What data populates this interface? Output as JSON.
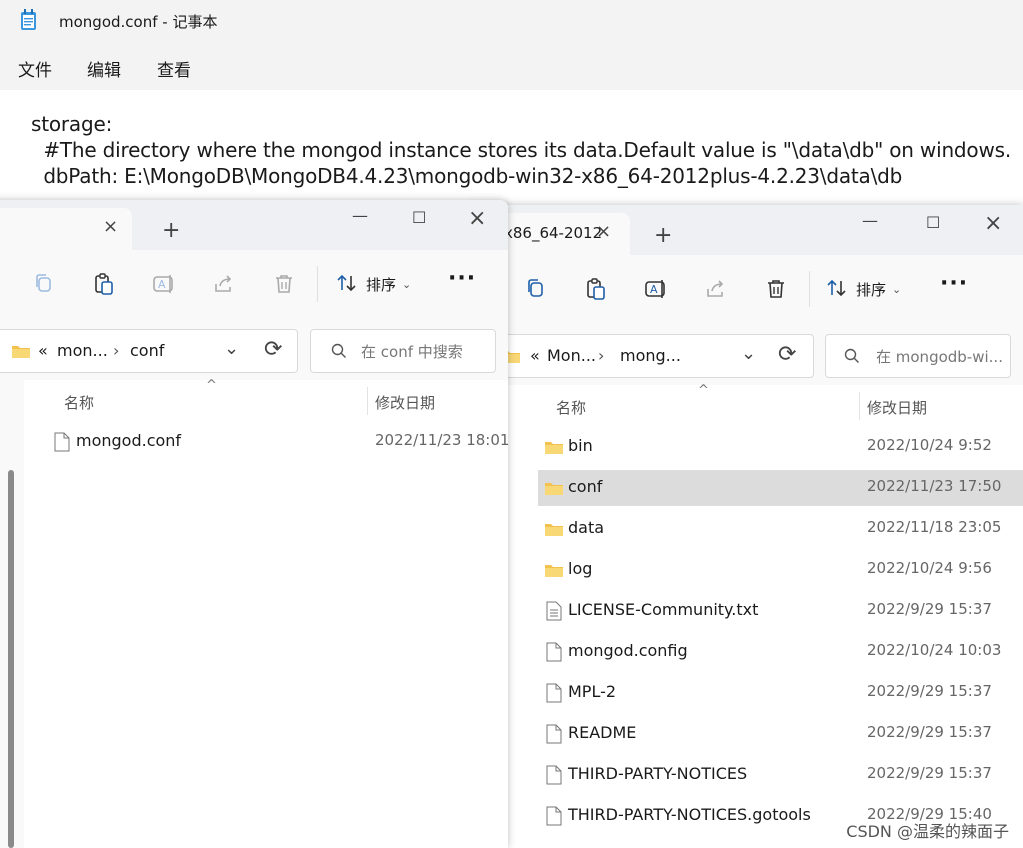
{
  "notepad": {
    "title": "mongod.conf - 记事本",
    "menu": [
      "文件",
      "编辑",
      "查看"
    ],
    "lines": [
      "storage:",
      "  #The directory where the mongod instance stores its data.Default value is \"\\data\\db\" on windows.",
      "  dbPath: E:\\MongoDB\\MongoDB4.4.23\\mongodb-win32-x86_64-2012plus-4.2.23\\data\\db"
    ]
  },
  "explorer_back": {
    "tab_title": "x86_64-2012",
    "sort_label": "排序",
    "breadcrumb": [
      "«",
      "Mon...",
      "mong..."
    ],
    "search_placeholder": "在 mongodb-wi...",
    "columns": [
      "名称",
      "修改日期"
    ],
    "rows": [
      {
        "name": "bin",
        "date": "2022/10/24 9:52",
        "type": "folder"
      },
      {
        "name": "conf",
        "date": "2022/11/23 17:50",
        "type": "folder",
        "selected": true
      },
      {
        "name": "data",
        "date": "2022/11/18 23:05",
        "type": "folder"
      },
      {
        "name": "log",
        "date": "2022/10/24 9:56",
        "type": "folder"
      },
      {
        "name": "LICENSE-Community.txt",
        "date": "2022/9/29 15:37",
        "type": "textfile"
      },
      {
        "name": "mongod.config",
        "date": "2022/10/24 10:03",
        "type": "file"
      },
      {
        "name": "MPL-2",
        "date": "2022/9/29 15:37",
        "type": "file"
      },
      {
        "name": "README",
        "date": "2022/9/29 15:37",
        "type": "file"
      },
      {
        "name": "THIRD-PARTY-NOTICES",
        "date": "2022/9/29 15:37",
        "type": "file"
      },
      {
        "name": "THIRD-PARTY-NOTICES.gotools",
        "date": "2022/9/29 15:40",
        "type": "file"
      }
    ]
  },
  "explorer_front": {
    "sort_label": "排序",
    "breadcrumb": [
      "«",
      "mon...",
      "conf"
    ],
    "search_placeholder": "在 conf 中搜索",
    "columns": [
      "名称",
      "修改日期"
    ],
    "rows": [
      {
        "name": "mongod.conf",
        "date": "2022/11/23 18:01",
        "type": "file"
      }
    ]
  },
  "watermark": "CSDN @温柔的辣面子",
  "icons": {
    "close": "×",
    "new_tab": "+",
    "minimize": "—",
    "maximize": "☐",
    "chevron_right": "›",
    "chevron_down": "⌄",
    "refresh": "⟳",
    "search": "⌕"
  }
}
